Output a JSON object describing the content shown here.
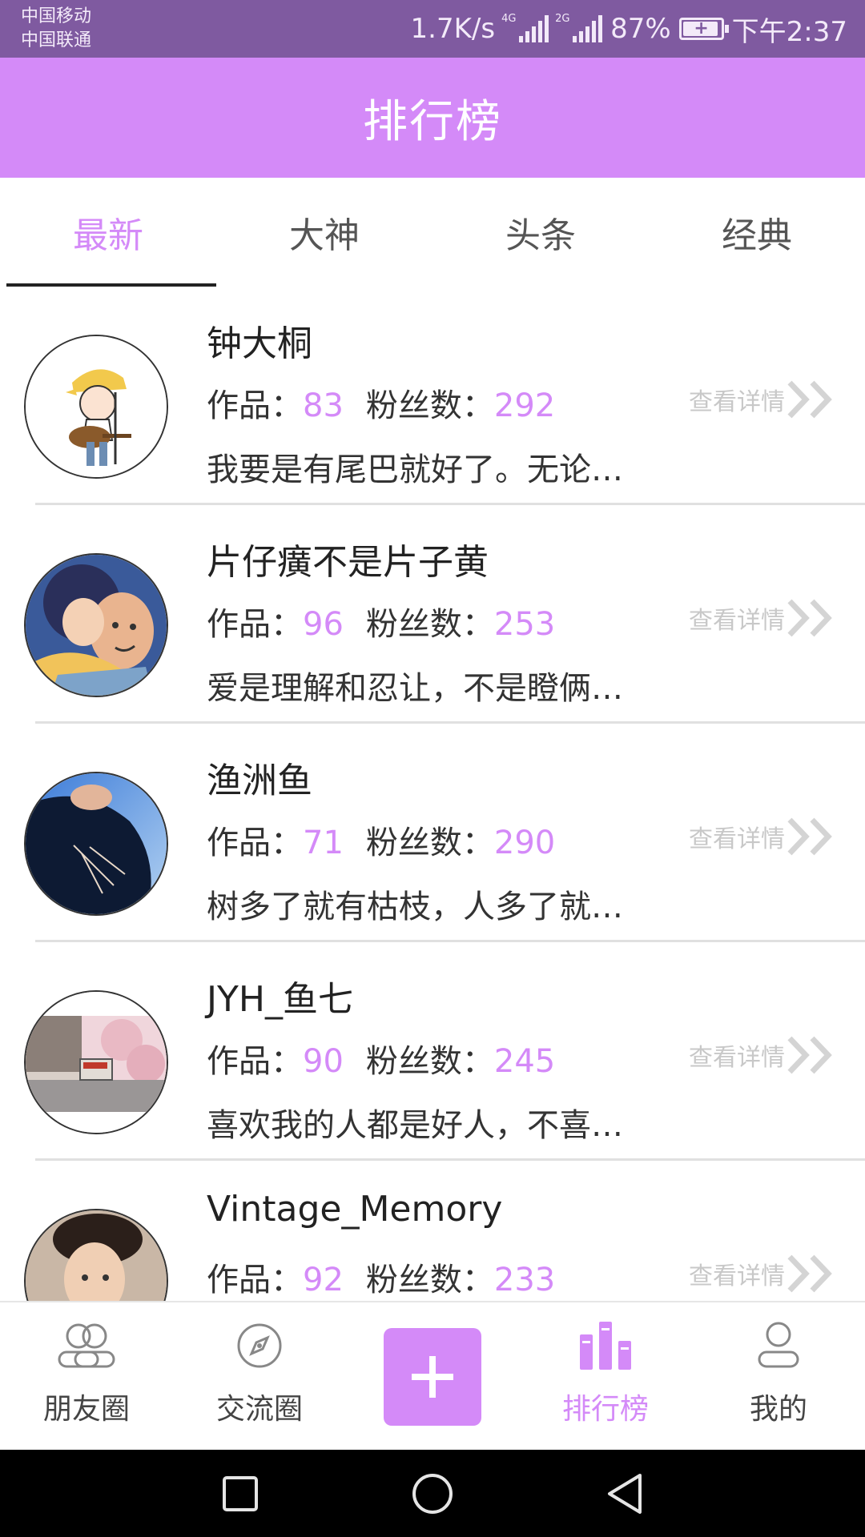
{
  "status_bar": {
    "carrier_1": "中国移动",
    "carrier_2": "中国联通",
    "speed": "1.7K/s",
    "net_1": "4G",
    "net_2": "2G",
    "battery": "87%",
    "time": "下午2:37"
  },
  "header": {
    "title": "排行榜"
  },
  "tabs": [
    {
      "label": "最新",
      "active": true
    },
    {
      "label": "大神",
      "active": false
    },
    {
      "label": "头条",
      "active": false
    },
    {
      "label": "经典",
      "active": false
    }
  ],
  "labels": {
    "works": "作品：",
    "fans": "粉丝数：",
    "detail": "查看详情"
  },
  "users": [
    {
      "name": "钟大桐",
      "works": "83",
      "fans": "292",
      "desc": "我要是有尾巴就好了。无论…"
    },
    {
      "name": "片仔癀不是片子黄",
      "works": "96",
      "fans": "253",
      "desc": "爱是理解和忍让，不是瞪俩…"
    },
    {
      "name": "渔洲鱼",
      "works": "71",
      "fans": "290",
      "desc": "树多了就有枯枝，人多了就…"
    },
    {
      "name": "JYH_鱼七",
      "works": "90",
      "fans": "245",
      "desc": "喜欢我的人都是好人，不喜…"
    },
    {
      "name": "Vintage_Memory",
      "works": "92",
      "fans": "233",
      "desc": ""
    }
  ],
  "bottom_nav": [
    {
      "label": "朋友圈",
      "icon": "friends-icon",
      "active": false
    },
    {
      "label": "交流圈",
      "icon": "compass-icon",
      "active": false
    },
    {
      "label": "",
      "icon": "plus-icon",
      "active": false
    },
    {
      "label": "排行榜",
      "icon": "ranking-icon",
      "active": true
    },
    {
      "label": "我的",
      "icon": "profile-icon",
      "active": false
    }
  ],
  "colors": {
    "accent": "#d48af8",
    "status_bar": "#7f5aa0"
  }
}
